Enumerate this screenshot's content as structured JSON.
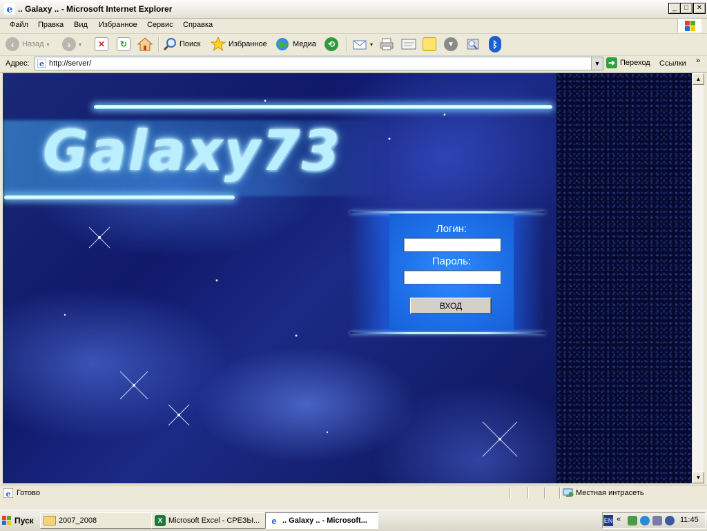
{
  "window": {
    "title": ".. Galaxy .. - Microsoft Internet Explorer",
    "controls": {
      "minimize": "_",
      "maximize": "□",
      "close": "✕"
    }
  },
  "menu": [
    "Файл",
    "Правка",
    "Вид",
    "Избранное",
    "Сервис",
    "Справка"
  ],
  "toolbar": {
    "back_label": "Назад",
    "search_label": "Поиск",
    "favorites_label": "Избранное",
    "media_label": "Медиа"
  },
  "address": {
    "label": "Адрес:",
    "url": "http://server/",
    "go_label": "Переход",
    "links_label": "Ссылки"
  },
  "page": {
    "logo_text": "Galaxy73",
    "login_label": "Логин:",
    "password_label": "Пароль:",
    "login_value": "",
    "password_value": "",
    "submit_label": "ВХОД"
  },
  "status": {
    "text": "Готово",
    "zone": "Местная интрасеть"
  },
  "taskbar": {
    "start_label": "Пуск",
    "tasks": [
      {
        "label": "2007_2008",
        "active": false
      },
      {
        "label": "Microsoft Excel - СРЕЗЫ...",
        "active": false
      },
      {
        "label": ".. Galaxy .. - Microsoft...",
        "active": true
      }
    ],
    "lang": "EN",
    "clock": "11:45"
  },
  "colors": {
    "login_panel": "#1e6fe8",
    "page_bg": "#0c1456",
    "ie_blue": "#1e5fc8"
  }
}
